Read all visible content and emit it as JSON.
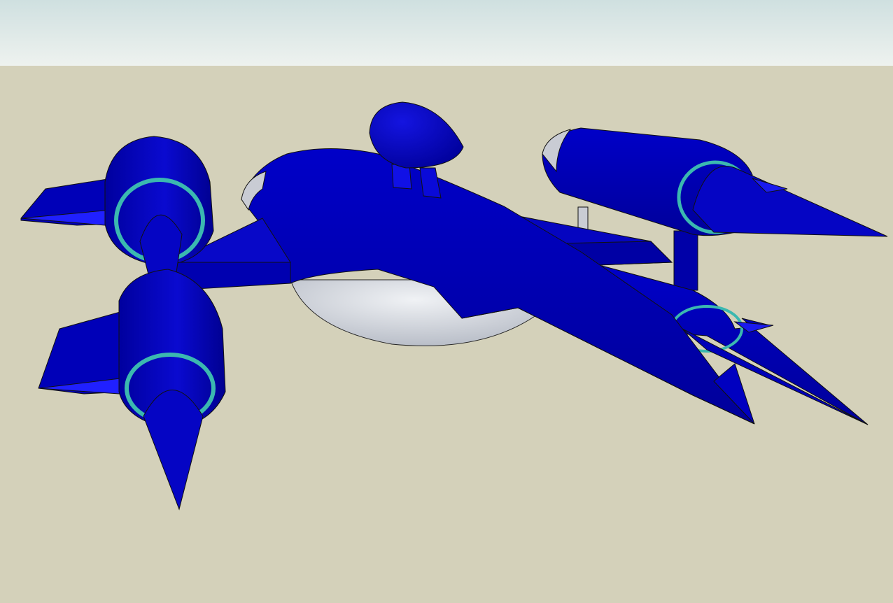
{
  "scene": {
    "colors": {
      "sky_top": "#cfe0e0",
      "sky_bottom": "#eef2ef",
      "ground": "#d4d1ba",
      "hull": "#0000b4",
      "hull_light": "#1a1ae6",
      "hull_dark": "#00008a",
      "underbody": "#e3e6ea",
      "underbody_shade": "#bfc4cc",
      "ring": "#3bb8b0",
      "outline": "#1a1a1a"
    }
  }
}
